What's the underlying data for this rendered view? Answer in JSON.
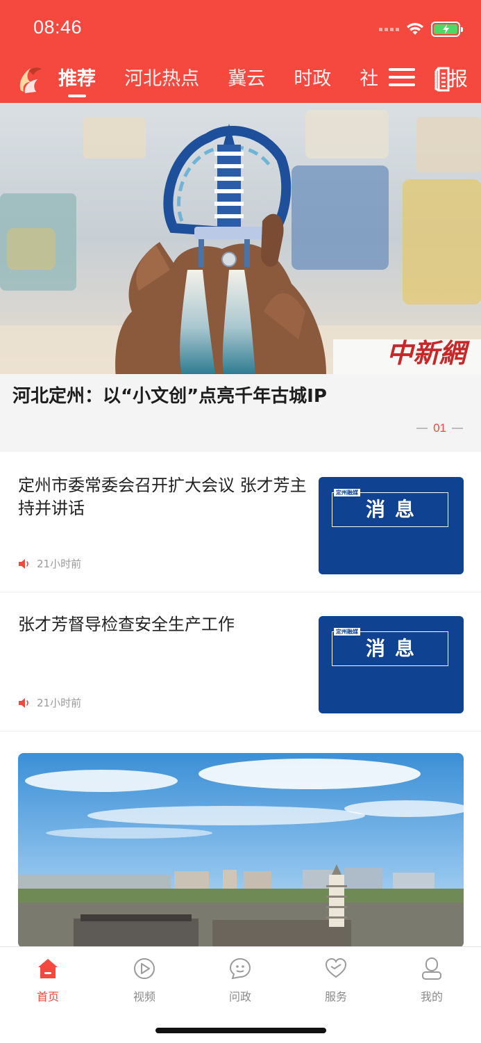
{
  "status_bar": {
    "time": "08:46"
  },
  "header": {
    "tabs": [
      {
        "label": "推荐",
        "active": true
      },
      {
        "label": "河北热点"
      },
      {
        "label": "冀云"
      },
      {
        "label": "时政"
      },
      {
        "label": "社"
      }
    ],
    "menu_icon": "hamburger-menu-icon",
    "epaper_icon": "newspaper-icon",
    "epaper_label": "报",
    "accent_color": "#f5483f"
  },
  "hero": {
    "title": "河北定州：以“小文创”点亮千年古城IP",
    "watermark": "中新網",
    "page_indicator": "01"
  },
  "news": [
    {
      "title": "定州市委常委会召开扩大会议 张才芳主持并讲话",
      "time": "21小时前",
      "thumb_tag": "定州融媒",
      "thumb_text": "消息"
    },
    {
      "title": "张才芳督导检查安全生产工作",
      "time": "21小时前",
      "thumb_tag": "定州融媒",
      "thumb_text": "消息"
    }
  ],
  "tabbar": {
    "items": [
      {
        "label": "首页",
        "icon": "home-icon",
        "active": true
      },
      {
        "label": "视频",
        "icon": "play-icon"
      },
      {
        "label": "问政",
        "icon": "chat-icon"
      },
      {
        "label": "服务",
        "icon": "heart-icon"
      },
      {
        "label": "我的",
        "icon": "user-icon"
      }
    ]
  }
}
